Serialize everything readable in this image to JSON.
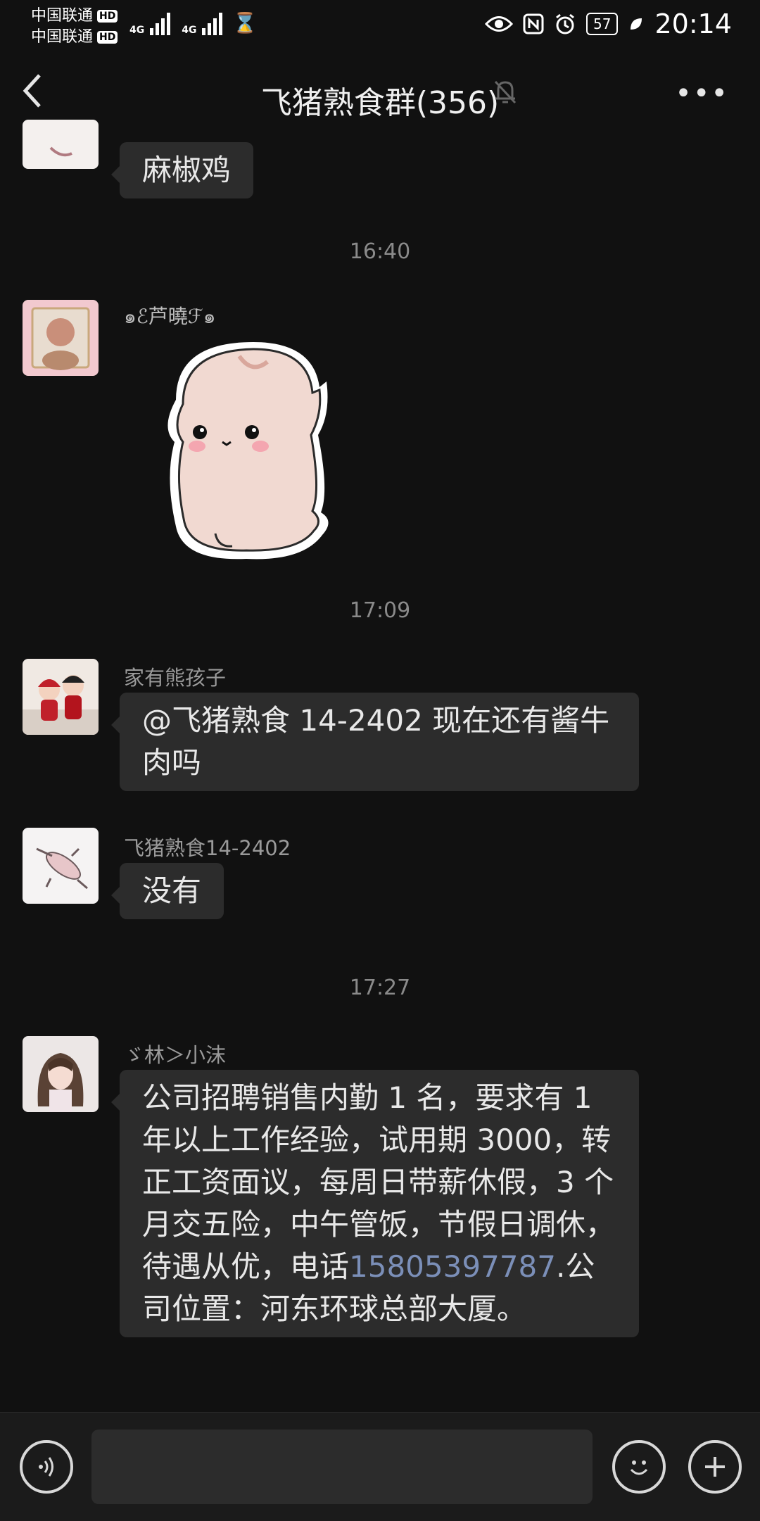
{
  "status_bar": {
    "carrier1": "中国联通",
    "carrier2": "中国联通",
    "hd1": "HD",
    "hd2": "HD",
    "net1": "4G",
    "net2": "4G",
    "battery": "57",
    "time": "20:14"
  },
  "header": {
    "title": "飞猪熟食群(356)",
    "more": "•••"
  },
  "messages": {
    "m1": {
      "text": "麻椒鸡"
    },
    "t1": "16:40",
    "m2": {
      "sender": "๑ℰ芦曉ℱ๑"
    },
    "t2": "17:09",
    "m3": {
      "sender": "家有熊孩子",
      "text": "@飞猪熟食 14-2402  现在还有酱牛肉吗"
    },
    "m4": {
      "sender": "飞猪熟食14-2402",
      "text": "没有"
    },
    "t3": "17:27",
    "m5": {
      "sender": "ゞ林＞小沫",
      "text_before": "公司招聘销售内勤 1 名，要求有 1 年以上工作经验，试用期 3000，转正工资面议，每周日带薪休假，3 个月交五险，中午管饭，节假日调休，待遇从优，电话",
      "phone": "15805397787",
      "text_after": ".公司位置：河东环球总部大厦。"
    }
  },
  "colors": {
    "background": "#111111",
    "bubble": "#2c2c2c",
    "link": "#7b8fb8"
  }
}
